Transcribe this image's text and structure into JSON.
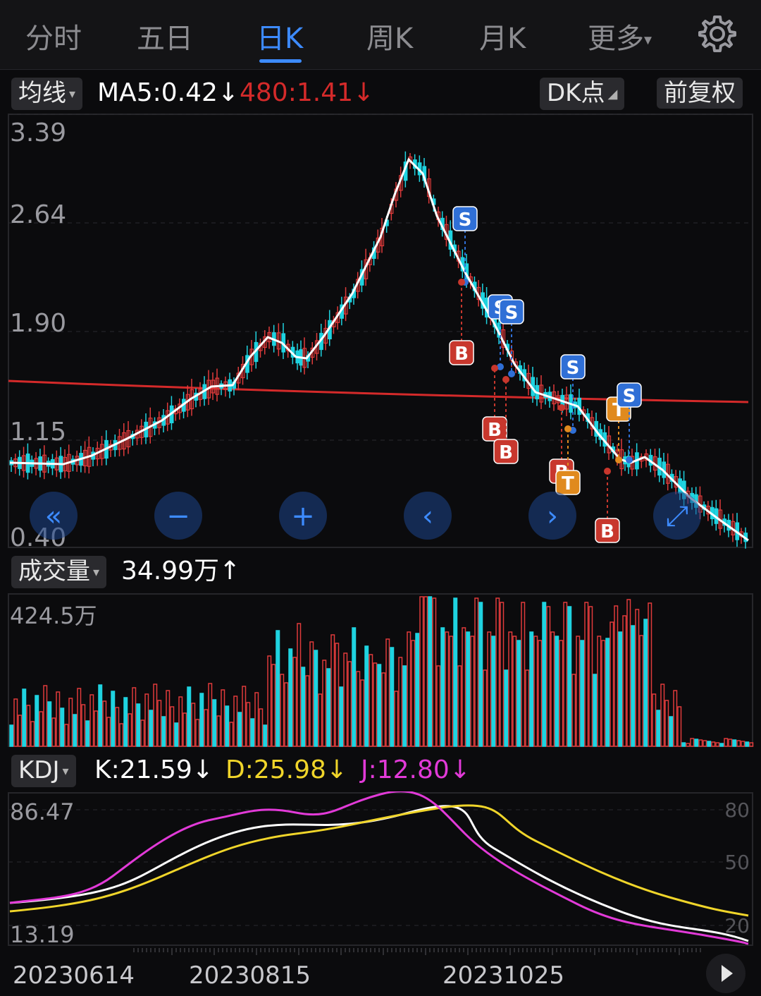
{
  "tabs": {
    "items": [
      "分时",
      "五日",
      "日K",
      "周K",
      "月K",
      "更多"
    ],
    "active": "日K",
    "more_caret": "▾"
  },
  "ma_bar": {
    "selector_label": "均线",
    "ma5": "MA5:0.42",
    "ma5_arrow": "↓",
    "ma480": "480:1.41",
    "ma480_arrow": "↓",
    "dk_button": "DK点",
    "adjust_button": "前复权"
  },
  "price_chart": {
    "axis_labels": [
      "3.39",
      "2.64",
      "1.90",
      "1.15",
      "0.40"
    ],
    "markers": [
      {
        "label": "S",
        "color": "#2f6fd6"
      },
      {
        "label": "B",
        "color": "#c8372d"
      },
      {
        "label": "T",
        "color": "#e08a1e"
      }
    ],
    "controls": [
      "«",
      "−",
      "+",
      "‹",
      "›",
      "⤢"
    ]
  },
  "volume_bar": {
    "selector_label": "成交量",
    "value": "34.99万",
    "arrow": "↑",
    "axis_top": "424.5万"
  },
  "kdj_bar": {
    "selector_label": "KDJ",
    "k": "K:21.59",
    "k_arrow": "↓",
    "d": "D:25.98",
    "d_arrow": "↓",
    "j": "J:12.80",
    "j_arrow": "↓",
    "axis_top": "86.47",
    "axis_bottom": "13.19",
    "right_levels": [
      "80",
      "50",
      "20"
    ]
  },
  "date_axis": {
    "labels": [
      "20230614",
      "20230815",
      "20231025"
    ]
  },
  "colors": {
    "up": "#e03b3b",
    "down": "#1fd3e0",
    "ma5": "#ffffff",
    "ma480": "#d42a2a",
    "k": "#ffffff",
    "d": "#f0d52a",
    "j": "#e23ad8",
    "accent": "#3d8bff"
  }
}
